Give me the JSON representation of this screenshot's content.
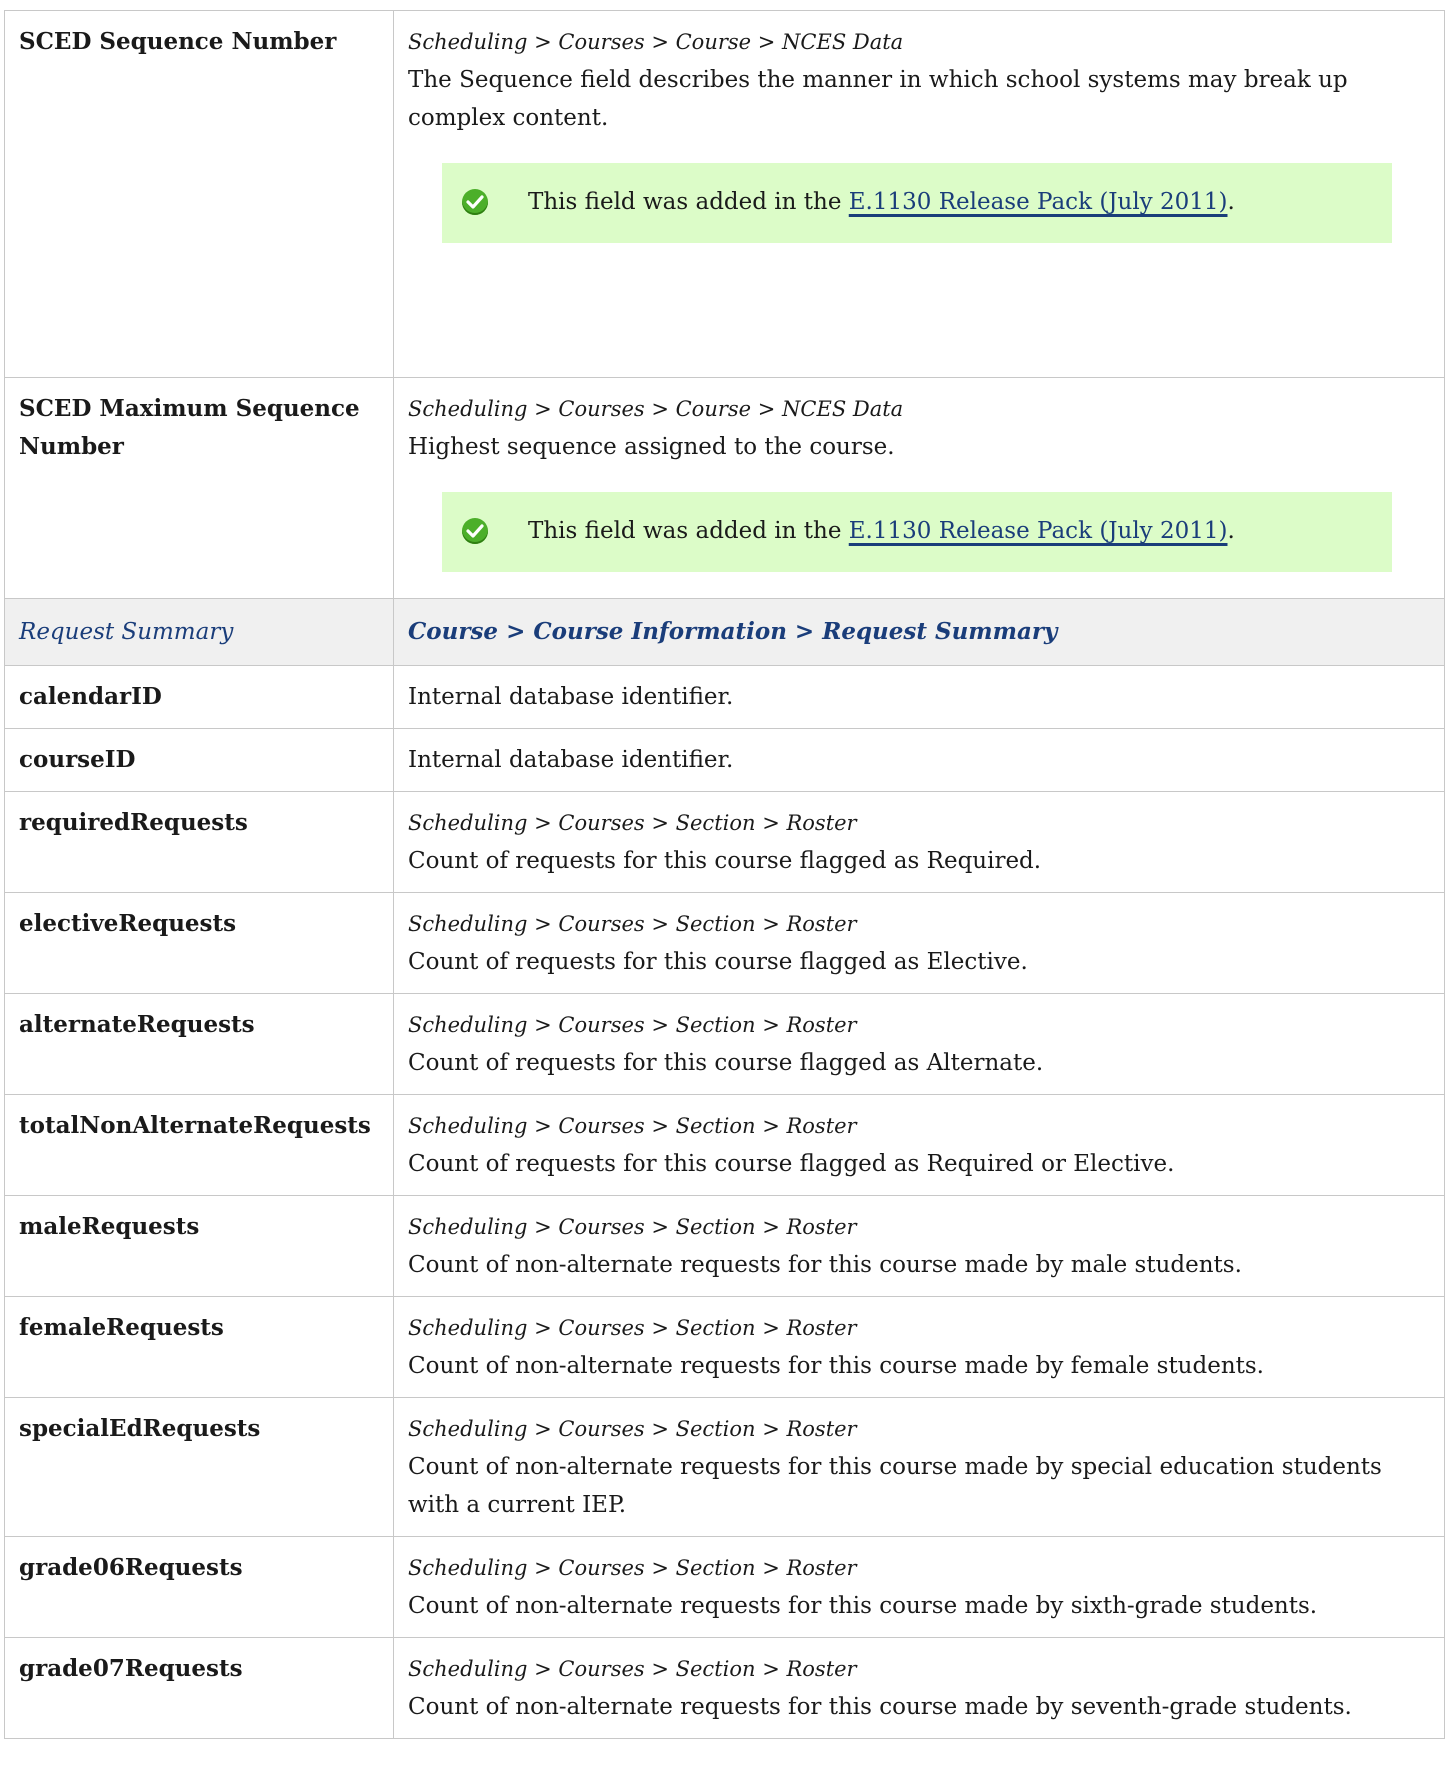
{
  "rows_top": [
    {
      "field": "SCED Sequence Number",
      "path": "Scheduling > Courses > Course > NCES Data",
      "description": "The Sequence field describes the manner in which school systems may break up complex content.",
      "note": {
        "text": "This field was added in the ",
        "link": "E.1130 Release Pack (July 2011)",
        "after": "."
      }
    },
    {
      "field": "SCED Maximum Sequence Number",
      "path": "Scheduling > Courses > Course > NCES Data",
      "description": "Highest sequence assigned to the course.",
      "note": {
        "text": "This field was added in the ",
        "link": "E.1130 Release Pack (July 2011)",
        "after": "."
      }
    }
  ],
  "section": {
    "name": "Request Summary",
    "path": "Course > Course Information > Request Summary"
  },
  "rows": [
    {
      "field": "calendarID",
      "path": "",
      "description": "Internal database identifier."
    },
    {
      "field": "courseID",
      "path": "",
      "description": "Internal database identifier."
    },
    {
      "field": "requiredRequests",
      "path": "Scheduling > Courses > Section > Roster",
      "description": "Count of requests for this course flagged as Required."
    },
    {
      "field": "electiveRequests",
      "path": "Scheduling > Courses > Section > Roster",
      "description": "Count of requests for this course flagged as Elective."
    },
    {
      "field": "alternateRequests",
      "path": "Scheduling > Courses > Section > Roster",
      "description": "Count of requests for this course flagged as Alternate."
    },
    {
      "field": "totalNonAlternateRequests",
      "path": "Scheduling > Courses > Section > Roster",
      "description": "Count of requests for this course flagged as Required or Elective."
    },
    {
      "field": "maleRequests",
      "path": "Scheduling > Courses > Section > Roster",
      "description": "Count of non-alternate requests for this course made by male students."
    },
    {
      "field": "femaleRequests",
      "path": "Scheduling > Courses > Section > Roster",
      "description": "Count of non-alternate requests for this course made by female students."
    },
    {
      "field": "specialEdRequests",
      "path": "Scheduling > Courses > Section > Roster",
      "description": "Count of non-alternate requests for this course made by special education students with a current IEP."
    },
    {
      "field": "grade06Requests",
      "path": "Scheduling > Courses > Section > Roster",
      "description": "Count of non-alternate requests for this course made by sixth-grade students."
    },
    {
      "field": "grade07Requests",
      "path": "Scheduling > Courses > Section > Roster",
      "description": "Count of non-alternate requests for this course made by seventh-grade students."
    }
  ]
}
